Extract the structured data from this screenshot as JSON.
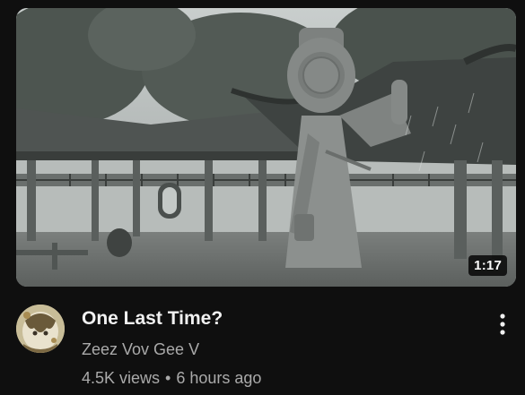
{
  "video": {
    "title": "One Last Time?",
    "duration": "1:17",
    "channel": "Zeez Vov Gee V",
    "views": "4.5K views",
    "separator": "•",
    "age": "6 hours ago"
  },
  "icons": {
    "menu": "more-vert-icon"
  },
  "colors": {
    "background": "#0f0f0f",
    "title": "#f1f1f1",
    "secondary_text": "#aaaaaa"
  }
}
